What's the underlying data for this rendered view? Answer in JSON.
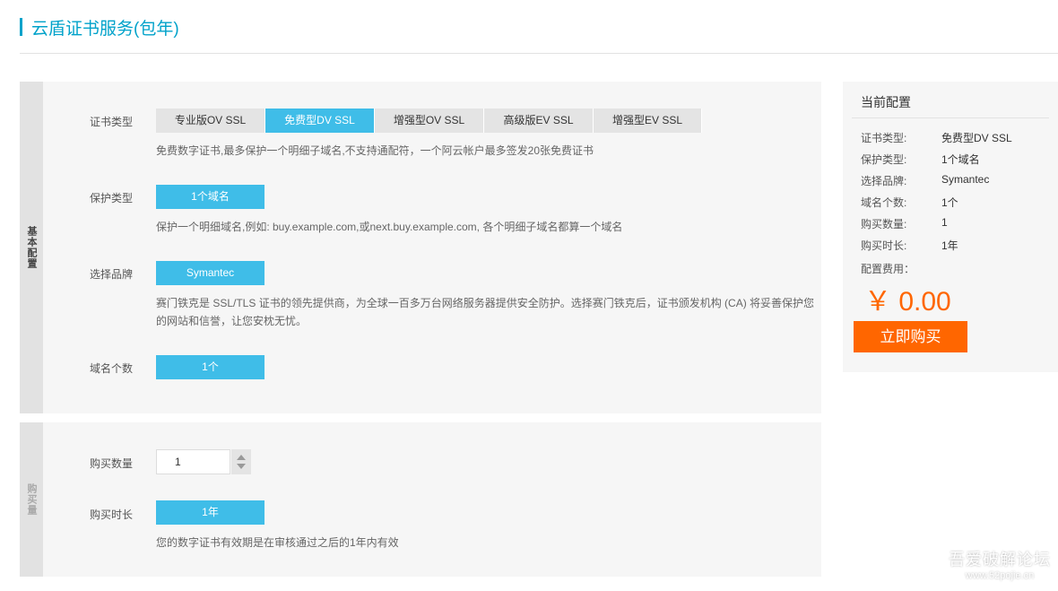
{
  "page": {
    "title": "云盾证书服务(包年)"
  },
  "basic_section": {
    "side_label": "基本配置",
    "cert_type": {
      "label": "证书类型",
      "options": [
        "专业版OV SSL",
        "免费型DV SSL",
        "增强型OV SSL",
        "高级版EV SSL",
        "增强型EV SSL"
      ],
      "selected": "免费型DV SSL",
      "desc": "免费数字证书,最多保护一个明细子域名,不支持通配符，一个阿云帐户最多签发20张免费证书"
    },
    "protect_type": {
      "label": "保护类型",
      "value": "1个域名",
      "desc": "保护一个明细域名,例如: buy.example.com,或next.buy.example.com, 各个明细子域名都算一个域名"
    },
    "brand": {
      "label": "选择品牌",
      "value": "Symantec",
      "desc_line1": "赛门铁克是 SSL/TLS 证书的领先提供商，为全球一百多万台网络服务器提供安全防护。选择赛门铁克后，证书颁发机构 (CA) 将妥善保护您",
      "desc_line2": "的网站和信誉，让您安枕无忧。"
    },
    "domain_count": {
      "label": "域名个数",
      "value": "1个"
    }
  },
  "purchase_section": {
    "side_label": "购买量",
    "quantity": {
      "label": "购买数量",
      "value": "1"
    },
    "duration": {
      "label": "购买时长",
      "value": "1年",
      "desc": "您的数字证书有效期是在审核通过之后的1年内有效"
    }
  },
  "summary": {
    "title": "当前配置",
    "rows": [
      {
        "label": "证书类型:",
        "value": "免费型DV SSL"
      },
      {
        "label": "保护类型:",
        "value": "1个域名"
      },
      {
        "label": "选择品牌:",
        "value": "Symantec"
      },
      {
        "label": "域名个数:",
        "value": "1个"
      },
      {
        "label": "购买数量:",
        "value": "1"
      },
      {
        "label": "购买时长:",
        "value": "1年"
      }
    ],
    "fee_label": "配置费用：",
    "price": "￥ 0.00",
    "buy_button": "立即购买"
  },
  "watermark": {
    "line1": "吾爱破解论坛",
    "line2": "www.52pojie.cn"
  },
  "colors": {
    "accent": "#00a2ca",
    "selected": "#3fbde8",
    "buy": "#ff6600"
  }
}
